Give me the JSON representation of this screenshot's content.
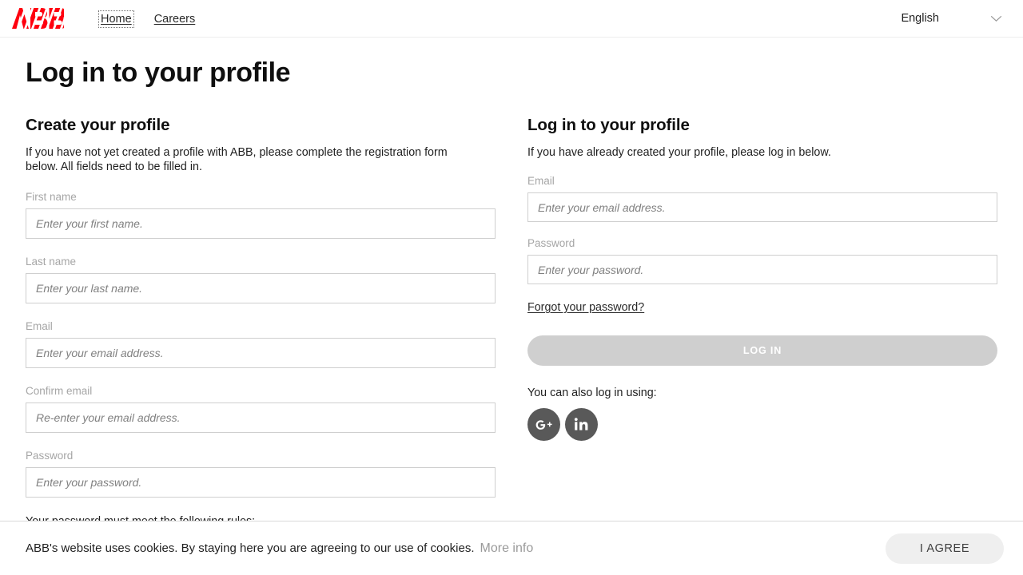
{
  "header": {
    "logo_alt": "ABB",
    "nav": [
      {
        "label": "Home",
        "focused": true
      },
      {
        "label": "Careers",
        "focused": false
      }
    ],
    "language": {
      "selected": "English",
      "icon": "chevron-down-icon"
    }
  },
  "page": {
    "title": "Log in to your profile"
  },
  "register": {
    "title": "Create your profile",
    "description": "If you have not yet created a profile with ABB, please complete the registration form below. All fields need to be filled in.",
    "fields": [
      {
        "label": "First name",
        "placeholder": "Enter your first name.",
        "value": "",
        "type": "text",
        "name": "first-name"
      },
      {
        "label": "Last name",
        "placeholder": "Enter your last name.",
        "value": "",
        "type": "text",
        "name": "last-name"
      },
      {
        "label": "Email",
        "placeholder": "Enter your email address.",
        "value": "",
        "type": "text",
        "name": "email"
      },
      {
        "label": "Confirm email",
        "placeholder": "Re-enter your email address.",
        "value": "",
        "type": "text",
        "name": "confirm-email"
      },
      {
        "label": "Password",
        "placeholder": "Enter your password.",
        "value": "",
        "type": "password",
        "name": "password"
      }
    ],
    "rules_heading": "Your password must meet the following rules:"
  },
  "login": {
    "title": "Log in to your profile",
    "description": "If you have already created your profile, please log in below.",
    "fields": [
      {
        "label": "Email",
        "placeholder": "Enter your email address.",
        "value": "",
        "type": "text",
        "name": "login-email"
      },
      {
        "label": "Password",
        "placeholder": "Enter your password.",
        "value": "",
        "type": "password",
        "name": "login-password"
      }
    ],
    "forgot_label": "Forgot your password?",
    "submit_label": "LOG IN",
    "submit_disabled": true,
    "social_heading": "You can also log in using:",
    "social": [
      {
        "name": "google-plus-icon",
        "label": "G+"
      },
      {
        "name": "linkedin-icon",
        "label": "in"
      }
    ]
  },
  "cookie": {
    "message": "ABB's website uses cookies. By staying here you are agreeing to our use of cookies.",
    "more_info_label": "More info",
    "agree_label": "I AGREE"
  },
  "colors": {
    "brand_red": "#ff000f",
    "input_border": "#cfcfcf",
    "label_gray": "#a6a6a6",
    "disabled_button": "#cfcfcf",
    "social_circle": "#595959",
    "agree_button": "#efefef"
  }
}
